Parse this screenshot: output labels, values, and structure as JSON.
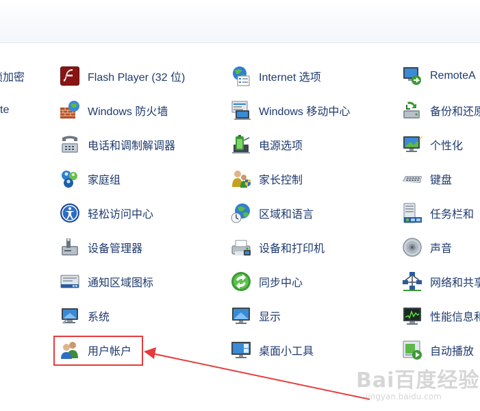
{
  "control_panel": {
    "partial_left": [
      {
        "label": "锁加密",
        "icon": "partial-icon"
      },
      {
        "label": "te",
        "icon": "partial-icon"
      }
    ],
    "columns": [
      [
        {
          "label": "Flash Player (32 位)",
          "icon": "flash-player-icon"
        },
        {
          "label": "Windows 防火墙",
          "icon": "firewall-icon"
        },
        {
          "label": "电话和调制解调器",
          "icon": "phone-modem-icon"
        },
        {
          "label": "家庭组",
          "icon": "homegroup-icon"
        },
        {
          "label": "轻松访问中心",
          "icon": "ease-of-access-icon"
        },
        {
          "label": "设备管理器",
          "icon": "device-manager-icon"
        },
        {
          "label": "通知区域图标",
          "icon": "notification-area-icon"
        },
        {
          "label": "系统",
          "icon": "system-icon"
        },
        {
          "label": "用户帐户",
          "icon": "user-accounts-icon"
        }
      ],
      [
        {
          "label": "Internet 选项",
          "icon": "internet-options-icon"
        },
        {
          "label": "Windows 移动中心",
          "icon": "mobility-center-icon"
        },
        {
          "label": "电源选项",
          "icon": "power-options-icon"
        },
        {
          "label": "家长控制",
          "icon": "parental-controls-icon"
        },
        {
          "label": "区域和语言",
          "icon": "region-language-icon"
        },
        {
          "label": "设备和打印机",
          "icon": "devices-printers-icon"
        },
        {
          "label": "同步中心",
          "icon": "sync-center-icon"
        },
        {
          "label": "显示",
          "icon": "display-icon"
        },
        {
          "label": "桌面小工具",
          "icon": "desktop-gadgets-icon"
        }
      ],
      [
        {
          "label": "RemoteA",
          "icon": "remoteapp-icon"
        },
        {
          "label": "备份和还原",
          "icon": "backup-restore-icon"
        },
        {
          "label": "个性化",
          "icon": "personalization-icon"
        },
        {
          "label": "键盘",
          "icon": "keyboard-icon"
        },
        {
          "label": "任务栏和",
          "icon": "taskbar-icon"
        },
        {
          "label": "声音",
          "icon": "sound-icon"
        },
        {
          "label": "网络和共享",
          "icon": "network-sharing-icon"
        },
        {
          "label": "性能信息和",
          "icon": "performance-icon"
        },
        {
          "label": "自动播放",
          "icon": "autoplay-icon"
        }
      ]
    ]
  },
  "annotation": {
    "highlight_color": "#e53b3b"
  },
  "watermark": {
    "main": "Bai百度经验",
    "sub": "jingyan.baidu.com"
  }
}
